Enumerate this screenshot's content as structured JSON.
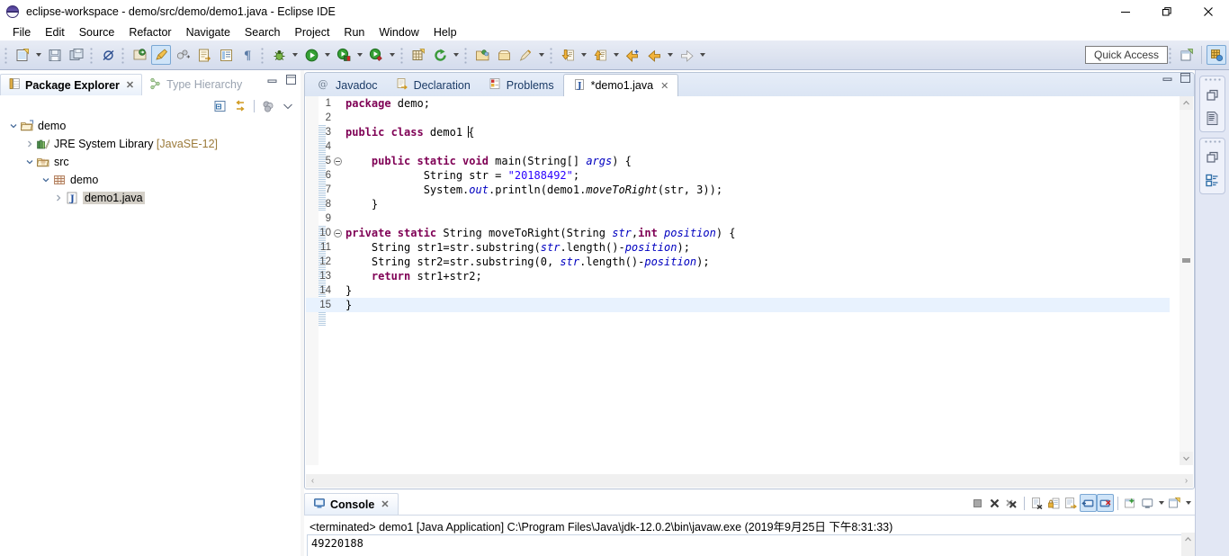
{
  "window": {
    "title": "eclipse-workspace - demo/src/demo/demo1.java - Eclipse IDE",
    "icon": "eclipse-logo-icon",
    "controls": {
      "minimize": "minimize-icon",
      "restore": "restore-icon",
      "close": "close-icon"
    }
  },
  "menubar": {
    "items": [
      {
        "label": "File"
      },
      {
        "label": "Edit"
      },
      {
        "label": "Source"
      },
      {
        "label": "Refactor"
      },
      {
        "label": "Navigate"
      },
      {
        "label": "Search"
      },
      {
        "label": "Project"
      },
      {
        "label": "Run"
      },
      {
        "label": "Window"
      },
      {
        "label": "Help"
      }
    ]
  },
  "toolbar": {
    "quick_access_placeholder": "Quick Access",
    "groups": [
      {
        "items": [
          {
            "name": "new-wizard-button",
            "icon": "new-file-icon",
            "dropdown": true
          },
          {
            "name": "save-button",
            "icon": "save-icon"
          },
          {
            "name": "save-all-button",
            "icon": "save-all-icon"
          }
        ]
      },
      {
        "items": [
          {
            "name": "toggle-breakpoint-button",
            "icon": "skip-breakpoints-icon"
          }
        ]
      },
      {
        "items": [
          {
            "name": "new-java-package-button",
            "icon": "new-java-package-icon"
          },
          {
            "name": "new-java-class-button",
            "icon": "new-java-class-icon",
            "active": true
          },
          {
            "name": "new-java-interface-button",
            "icon": "new-java-interface-icon"
          }
        ]
      },
      {
        "items": [
          {
            "name": "open-type-button",
            "icon": "open-type-icon"
          },
          {
            "name": "open-task-button",
            "icon": "open-task-icon"
          },
          {
            "name": "show-whitespace-button",
            "icon": "pilcrow-icon"
          }
        ]
      },
      {
        "items": [
          {
            "name": "debug-button",
            "icon": "debug-bug-icon",
            "dropdown": true
          },
          {
            "name": "run-button",
            "icon": "run-play-icon",
            "dropdown": true
          },
          {
            "name": "coverage-button",
            "icon": "run-coverage-icon",
            "dropdown": true
          },
          {
            "name": "external-tools-button",
            "icon": "external-tools-icon",
            "dropdown": true
          }
        ]
      },
      {
        "items": [
          {
            "name": "new-table-button",
            "icon": "new-table-icon"
          },
          {
            "name": "refresh-button",
            "icon": "refresh-green-icon",
            "dropdown": true
          }
        ]
      },
      {
        "items": [
          {
            "name": "open-perspective-button",
            "icon": "open-folder-icon"
          },
          {
            "name": "open-resource-button",
            "icon": "open-box-icon"
          },
          {
            "name": "annotation-button",
            "icon": "pen-icon",
            "dropdown": true
          }
        ]
      },
      {
        "items": [
          {
            "name": "next-annotation-button",
            "icon": "down-arrow-doc-icon",
            "dropdown": true
          },
          {
            "name": "previous-annotation-button",
            "icon": "up-arrow-doc-icon",
            "dropdown": true
          },
          {
            "name": "last-edit-location-button",
            "icon": "last-edit-arrow-icon"
          },
          {
            "name": "back-button",
            "icon": "back-arrow-icon",
            "dropdown": true
          },
          {
            "name": "forward-button",
            "icon": "forward-arrow-icon",
            "dropdown": true
          }
        ]
      }
    ],
    "right_items": [
      {
        "name": "new-perspective-button",
        "icon": "new-perspective-icon"
      },
      {
        "name": "java-perspective-button",
        "icon": "java-perspective-icon",
        "active": true
      }
    ]
  },
  "package_explorer": {
    "tabs": [
      {
        "label": "Package Explorer",
        "icon": "package-explorer-icon",
        "selected": true,
        "closable": true
      },
      {
        "label": "Type Hierarchy",
        "icon": "type-hierarchy-icon",
        "selected": false,
        "closable": false
      }
    ],
    "view_toolbar": [
      {
        "name": "collapse-all-button",
        "icon": "collapse-all-icon"
      },
      {
        "name": "link-with-editor-button",
        "icon": "link-editor-icon"
      },
      {
        "name": "view-menu-filters-button",
        "icon": "filters-icon"
      },
      {
        "name": "view-menu-button",
        "icon": "chevron-down-icon"
      }
    ],
    "tree": [
      {
        "depth": 0,
        "twisty": "down",
        "icon": "project-folder-icon",
        "label": "demo",
        "suffix": "",
        "selected": false
      },
      {
        "depth": 1,
        "twisty": "right",
        "icon": "jre-library-icon",
        "label": "JRE System Library",
        "suffix": " [JavaSE-12]",
        "selected": false
      },
      {
        "depth": 1,
        "twisty": "down",
        "icon": "source-folder-icon",
        "label": "src",
        "suffix": "",
        "selected": false
      },
      {
        "depth": 2,
        "twisty": "down",
        "icon": "package-icon",
        "label": "demo",
        "suffix": "",
        "selected": false
      },
      {
        "depth": 3,
        "twisty": "right",
        "icon": "java-file-icon",
        "label": "demo1.java",
        "suffix": "",
        "selected": true
      }
    ]
  },
  "editor": {
    "tabs": [
      {
        "label": "Javadoc",
        "icon": "javadoc-icon",
        "selected": false,
        "closable": false
      },
      {
        "label": "Declaration",
        "icon": "declaration-icon",
        "selected": false,
        "closable": false
      },
      {
        "label": "Problems",
        "icon": "problems-icon",
        "selected": false,
        "closable": false
      },
      {
        "label": "*demo1.java",
        "icon": "java-file-icon",
        "selected": true,
        "closable": true
      }
    ],
    "lines": [
      {
        "n": 1,
        "fold": false,
        "indent": 0,
        "tokens": [
          {
            "t": "package ",
            "c": "kw"
          },
          {
            "t": "demo;",
            "c": ""
          }
        ]
      },
      {
        "n": 2,
        "fold": false,
        "indent": 0,
        "tokens": []
      },
      {
        "n": 3,
        "fold": false,
        "indent": 0,
        "tokens": [
          {
            "t": "public class ",
            "c": "kw"
          },
          {
            "t": "demo1 ",
            "c": ""
          },
          {
            "t": "{",
            "c": "cursor"
          }
        ]
      },
      {
        "n": 4,
        "fold": false,
        "indent": 0,
        "tokens": []
      },
      {
        "n": 5,
        "fold": true,
        "indent": 0,
        "tokens": [
          {
            "t": "    public static void ",
            "c": "kw"
          },
          {
            "t": "main(String[] ",
            "c": ""
          },
          {
            "t": "args",
            "c": "fld"
          },
          {
            "t": ") {",
            "c": ""
          }
        ]
      },
      {
        "n": 6,
        "fold": false,
        "indent": 0,
        "tokens": [
          {
            "t": "            String str = ",
            "c": ""
          },
          {
            "t": "\"20188492\"",
            "c": "str"
          },
          {
            "t": ";",
            "c": ""
          }
        ]
      },
      {
        "n": 7,
        "fold": false,
        "indent": 0,
        "tokens": [
          {
            "t": "            System.",
            "c": ""
          },
          {
            "t": "out",
            "c": "fld"
          },
          {
            "t": ".println(demo1.",
            "c": ""
          },
          {
            "t": "moveToRight",
            "c": "mth"
          },
          {
            "t": "(str, 3));",
            "c": ""
          }
        ]
      },
      {
        "n": 8,
        "fold": false,
        "indent": 0,
        "tokens": [
          {
            "t": "    }",
            "c": ""
          }
        ]
      },
      {
        "n": 9,
        "fold": false,
        "indent": 0,
        "tokens": []
      },
      {
        "n": 10,
        "fold": true,
        "indent": 0,
        "tokens": [
          {
            "t": "private static ",
            "c": "kw"
          },
          {
            "t": "String moveToRight(String ",
            "c": ""
          },
          {
            "t": "str",
            "c": "fld"
          },
          {
            "t": ",",
            "c": ""
          },
          {
            "t": "int ",
            "c": "kw"
          },
          {
            "t": "position",
            "c": "fld"
          },
          {
            "t": ") {",
            "c": ""
          }
        ]
      },
      {
        "n": 11,
        "fold": false,
        "indent": 0,
        "tokens": [
          {
            "t": "    String str1=str.substring(",
            "c": ""
          },
          {
            "t": "str",
            "c": "fld"
          },
          {
            "t": ".length()-",
            "c": ""
          },
          {
            "t": "position",
            "c": "fld"
          },
          {
            "t": ");",
            "c": ""
          }
        ]
      },
      {
        "n": 12,
        "fold": false,
        "indent": 0,
        "tokens": [
          {
            "t": "    String str2=str.substring(0, ",
            "c": ""
          },
          {
            "t": "str",
            "c": "fld"
          },
          {
            "t": ".length()-",
            "c": ""
          },
          {
            "t": "position",
            "c": "fld"
          },
          {
            "t": ");",
            "c": ""
          }
        ]
      },
      {
        "n": 13,
        "fold": false,
        "indent": 0,
        "tokens": [
          {
            "t": "    ",
            "c": ""
          },
          {
            "t": "return ",
            "c": "kw"
          },
          {
            "t": "str1+str2;",
            "c": ""
          }
        ]
      },
      {
        "n": 14,
        "fold": false,
        "indent": 0,
        "tokens": [
          {
            "t": "}",
            "c": ""
          }
        ]
      },
      {
        "n": 15,
        "fold": false,
        "indent": 0,
        "highlight": true,
        "tokens": [
          {
            "t": "}",
            "c": ""
          }
        ]
      }
    ]
  },
  "console": {
    "tab": {
      "label": "Console",
      "icon": "console-icon",
      "closable": true
    },
    "header": "<terminated> demo1 [Java Application] C:\\Program Files\\Java\\jdk-12.0.2\\bin\\javaw.exe (2019年9月25日 下午8:31:33)",
    "output": "49220188",
    "toolbar": [
      {
        "name": "terminate-button",
        "icon": "terminate-square-icon"
      },
      {
        "name": "remove-launch-button",
        "icon": "remove-x-icon"
      },
      {
        "name": "remove-all-terminated-button",
        "icon": "remove-all-xx-icon"
      },
      {
        "name": "clear-console-button",
        "icon": "clear-console-icon",
        "sep_before": true
      },
      {
        "name": "scroll-lock-button",
        "icon": "scroll-lock-icon"
      },
      {
        "name": "word-wrap-button",
        "icon": "word-wrap-icon"
      },
      {
        "name": "show-console-on-output-button",
        "icon": "show-console-output-icon",
        "on": true
      },
      {
        "name": "show-console-on-error-button",
        "icon": "show-console-error-icon",
        "on": true
      },
      {
        "name": "pin-console-button",
        "icon": "pin-console-icon",
        "sep_before": true
      },
      {
        "name": "display-selected-console-button",
        "icon": "display-console-icon",
        "dropdown": true
      },
      {
        "name": "open-console-button",
        "icon": "open-console-icon",
        "dropdown": true
      }
    ]
  },
  "fastview": {
    "groups": [
      {
        "items": [
          {
            "name": "restore-view-button",
            "icon": "restore-view-icon"
          },
          {
            "name": "outline-view-button",
            "icon": "outline-doc-icon"
          }
        ]
      },
      {
        "items": [
          {
            "name": "restore-view-2-button",
            "icon": "restore-view-icon"
          },
          {
            "name": "task-list-view-button",
            "icon": "task-list-icon"
          }
        ]
      }
    ]
  },
  "colors": {
    "keyword": "#7f0055",
    "string": "#2a00ff",
    "field": "#0000c0",
    "accent_selected_tab": "#cfe4f8",
    "toolbar_bg": "#dde3f0",
    "fastview_bg": "#e2e7f4",
    "line_highlight": "#e8f2fe"
  }
}
